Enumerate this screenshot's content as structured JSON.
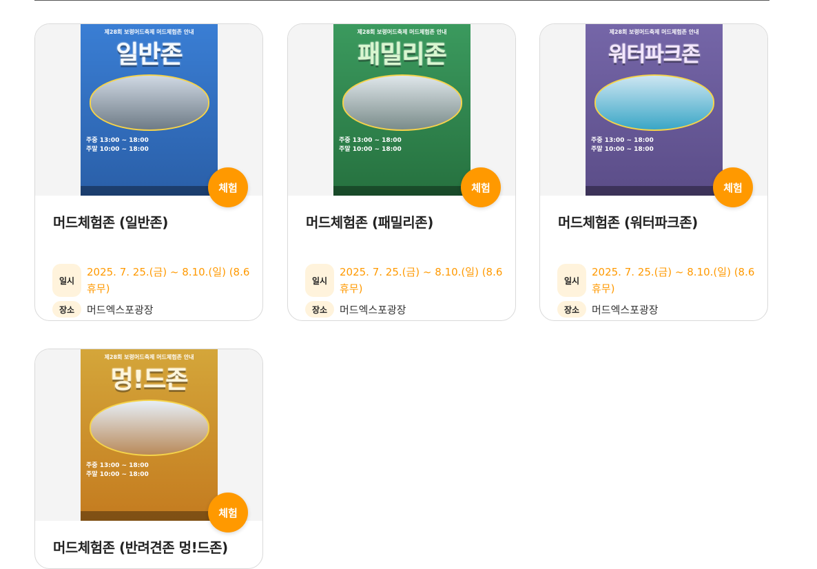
{
  "cards": [
    {
      "title": "머드체험존 (일반존)",
      "badge": "체험",
      "date_label": "일시",
      "date": "2025. 7. 25.(금) ~ 8.10.(일) (8.6휴무)",
      "place_label": "장소",
      "place": "머드엑스포광장",
      "poster": {
        "heading": "제28회 보령머드축제 머드체험존 안내",
        "zone": "일반존",
        "weekday": "주중 13:00 ~ 18:00",
        "weekend": "주말 10:00 ~ 18:00",
        "color": "#2f6fc2"
      }
    },
    {
      "title": "머드체험존 (패밀리존)",
      "badge": "체험",
      "date_label": "일시",
      "date": "2025. 7. 25.(금) ~ 8.10.(일) (8.6휴무)",
      "place_label": "장소",
      "place": "머드엑스포광장",
      "poster": {
        "heading": "제28회 보령머드축제 머드체험존 안내",
        "zone": "패밀리존",
        "weekday": "주중 13:00 ~ 18:00",
        "weekend": "주말 10:00 ~ 18:00",
        "color": "#2f8a52"
      }
    },
    {
      "title": "머드체험존 (워터파크존)",
      "badge": "체험",
      "date_label": "일시",
      "date": "2025. 7. 25.(금) ~ 8.10.(일) (8.6휴무)",
      "place_label": "장소",
      "place": "머드엑스포광장",
      "poster": {
        "heading": "제28회 보령머드축제 머드체험존 안내",
        "zone": "워터파크존",
        "weekday": "주중 13:00 ~ 18:00",
        "weekend": "주말 10:00 ~ 18:00",
        "color": "#6a5b9a"
      }
    },
    {
      "title": "머드체험존 (반려견존 멍!드존)",
      "badge": "체험",
      "poster": {
        "heading": "제28회 보령머드축제 머드체험존 안내",
        "zone": "멍!드존",
        "weekday": "주중 13:00 ~ 18:00",
        "weekend": "주말 10:00 ~ 18:00",
        "color": "#c99a2e"
      }
    }
  ]
}
